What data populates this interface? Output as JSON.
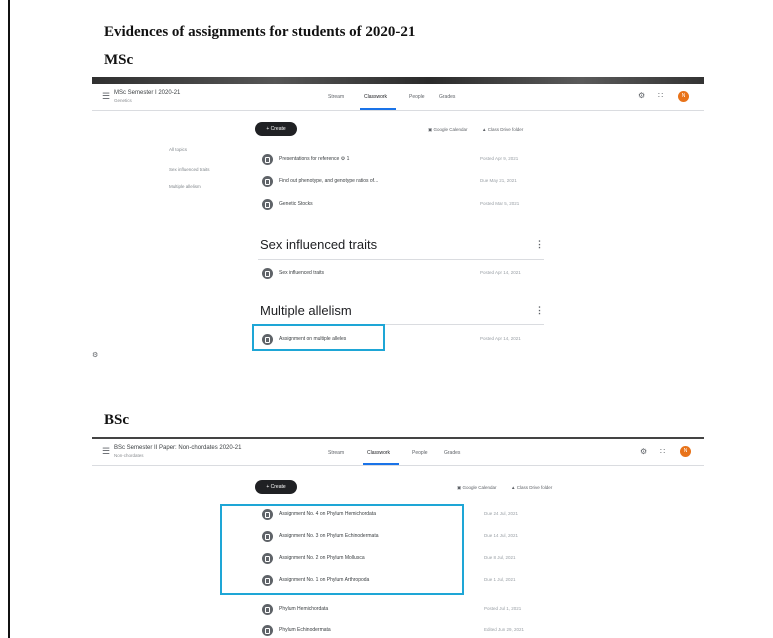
{
  "doc": {
    "title": "Evidences of assignments for students of 2020-21",
    "msc_heading": "MSc",
    "bsc_heading": "BSc"
  },
  "msc": {
    "class_name": "MSc Semester I 2020-21",
    "class_sub": "Genetics",
    "tabs": [
      "Stream",
      "Classwork",
      "People",
      "Grades"
    ],
    "active_tab": "Classwork",
    "create_label": "+ Create",
    "calendar_label": "Google Calendar",
    "drive_label": "Class Drive folder",
    "filters": [
      "All topics",
      "Sex influenced traits",
      "Multiple allelism"
    ],
    "items": [
      {
        "title": "Presentations for reference  ⚙ 1",
        "date": "Posted Apr 9, 2021"
      },
      {
        "title": "Find out phenotype, and genotype ratios of...",
        "date": "Due May 21, 2021"
      },
      {
        "title": "Genetic Stocks",
        "date": "Posted Mar 5, 2021"
      }
    ],
    "topic1": {
      "title": "Sex influenced traits",
      "items": [
        {
          "title": "Sex influenced traits",
          "date": "Posted Apr 14, 2021"
        }
      ]
    },
    "topic2": {
      "title": "Multiple allelism",
      "items": [
        {
          "title": "Assignment on multiple alleles",
          "date": "Posted Apr 14, 2021"
        }
      ]
    },
    "avatar_letter": "N"
  },
  "bsc": {
    "class_name": "BSc Semester II Paper: Non-chordates 2020-21",
    "class_sub": "Non-chordates",
    "tabs": [
      "Stream",
      "Classwork",
      "People",
      "Grades"
    ],
    "active_tab": "Classwork",
    "create_label": "+ Create",
    "calendar_label": "Google Calendar",
    "drive_label": "Class Drive folder",
    "items": [
      {
        "title": "Assignment No. 4 on Phylum Hemichordata",
        "date": "Due 24 Jul, 2021"
      },
      {
        "title": "Assignment No. 3 on Phylum Echinodermata",
        "date": "Due 14 Jul, 2021"
      },
      {
        "title": "Assignment No. 2 on Phylum Mollusca",
        "date": "Due 8 Jul, 2021"
      },
      {
        "title": "Assignment No. 1 on Phylum Arthropoda",
        "date": "Due 1 Jul, 2021"
      },
      {
        "title": "Phylum Hemichordata",
        "date": "Posted Jul 1, 2021"
      },
      {
        "title": "Phylum Echinodermata",
        "date": "Edited Jun 29, 2021"
      }
    ],
    "avatar_letter": "N"
  },
  "icons": [
    "menu-icon",
    "settings-icon",
    "apps-grid-icon",
    "assignment-icon",
    "more-vert-icon",
    "calendar-icon",
    "drive-folder-icon"
  ],
  "colors": {
    "highlight": "#1ea6d6",
    "avatar": "#e8731a",
    "create_button": "#202124",
    "tab_active": "#1a73e8"
  }
}
